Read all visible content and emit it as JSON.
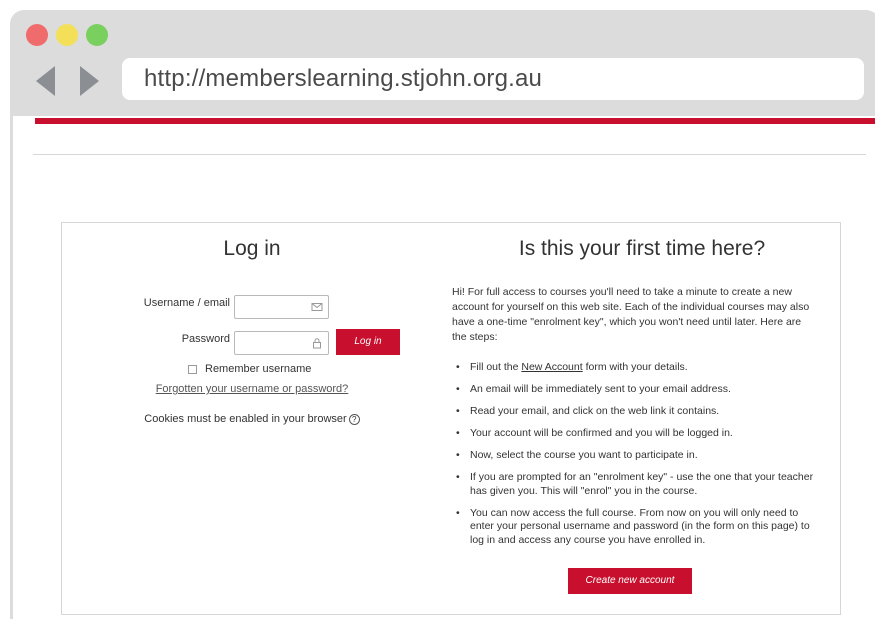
{
  "browser": {
    "url": "http://memberslearning.stjohn.org.au",
    "colors": {
      "close": "#f06b6b",
      "minimize": "#f4df58",
      "maximize": "#7ad05f",
      "accent": "#c8102e"
    }
  },
  "login": {
    "title": "Log in",
    "username_label": "Username / email",
    "username_value": "",
    "password_label": "Password",
    "password_value": "",
    "login_button": "Log in",
    "remember_label": "Remember username",
    "forgot_link": "Forgotten your username or password?",
    "cookies_text": "Cookies must be enabled in your browser",
    "icons": {
      "username": "envelope-icon",
      "password": "lock-icon",
      "help": "help-circle-icon"
    }
  },
  "signup": {
    "title": "Is this your first time here?",
    "intro": "Hi! For full access to courses you'll need to take a minute to create a new account for yourself on this web site. Each of the individual courses may also have a one-time \"enrolment key\", which you won't need until later. Here are the steps:",
    "step1_pre": "Fill out the ",
    "step1_link": "New Account",
    "step1_post": " form with your details.",
    "steps": [
      "An email will be immediately sent to your email address.",
      "Read your email, and click on the web link it contains.",
      "Your account will be confirmed and you will be logged in.",
      "Now, select the course you want to participate in.",
      "If you are prompted for an \"enrolment key\" - use the one that your teacher has given you. This will \"enrol\" you in the course.",
      "You can now access the full course. From now on you will only need to enter your personal username and password (in the form on this page) to log in and access any course you have enrolled in."
    ],
    "create_button": "Create new account"
  }
}
